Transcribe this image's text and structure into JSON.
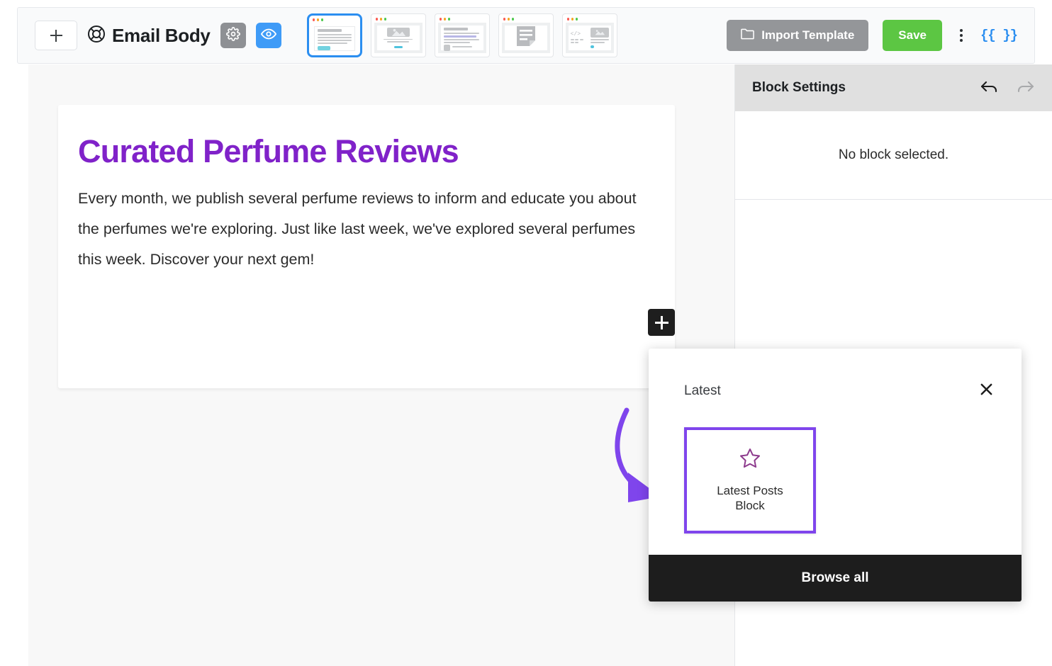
{
  "toolbar": {
    "add_block_label": "+",
    "add_block_icon": "plus-icon",
    "brand_icon": "lifebuoy-icon",
    "brand_title": "Email Body",
    "settings_icon": "gear-icon",
    "preview_icon": "eye-icon",
    "import_label": "Import Template",
    "import_icon": "folder-icon",
    "save_label": "Save",
    "more_icon": "kebab-menu-icon",
    "merge_tag_label": "{{ }}",
    "templates": [
      {
        "name": "text-template",
        "selected": true
      },
      {
        "name": "image-text-template",
        "selected": false
      },
      {
        "name": "article-list-template",
        "selected": false
      },
      {
        "name": "document-template",
        "selected": false
      },
      {
        "name": "code-image-template",
        "selected": false
      }
    ]
  },
  "canvas": {
    "email": {
      "heading": "Curated Perfume Reviews",
      "paragraph": "Every month, we publish several perfume reviews to inform and educate you about the perfumes we're exploring. Just like last week, we've explored several perfumes this week. Discover your next gem!"
    },
    "add_block_icon": "plus-icon",
    "annotation_arrow_icon": "curved-arrow-icon"
  },
  "panel": {
    "title": "Block Settings",
    "undo_icon": "undo-arrow-icon",
    "redo_icon": "redo-arrow-icon",
    "empty_message": "No block selected."
  },
  "inserter": {
    "header_title": "Latest",
    "close_icon": "close-x-icon",
    "block_icon": "star-outline-icon",
    "block_label": "Latest Posts Block",
    "browse_all_label": "Browse all"
  },
  "colors": {
    "accent_purple": "#8022c9",
    "annotation_purple": "#7f45ec",
    "save_green": "#5cc643",
    "preview_blue": "#3f9bf7",
    "selected_border_blue": "#2b8ef0",
    "import_grey": "#949699",
    "footer_black": "#1d1d1d"
  }
}
